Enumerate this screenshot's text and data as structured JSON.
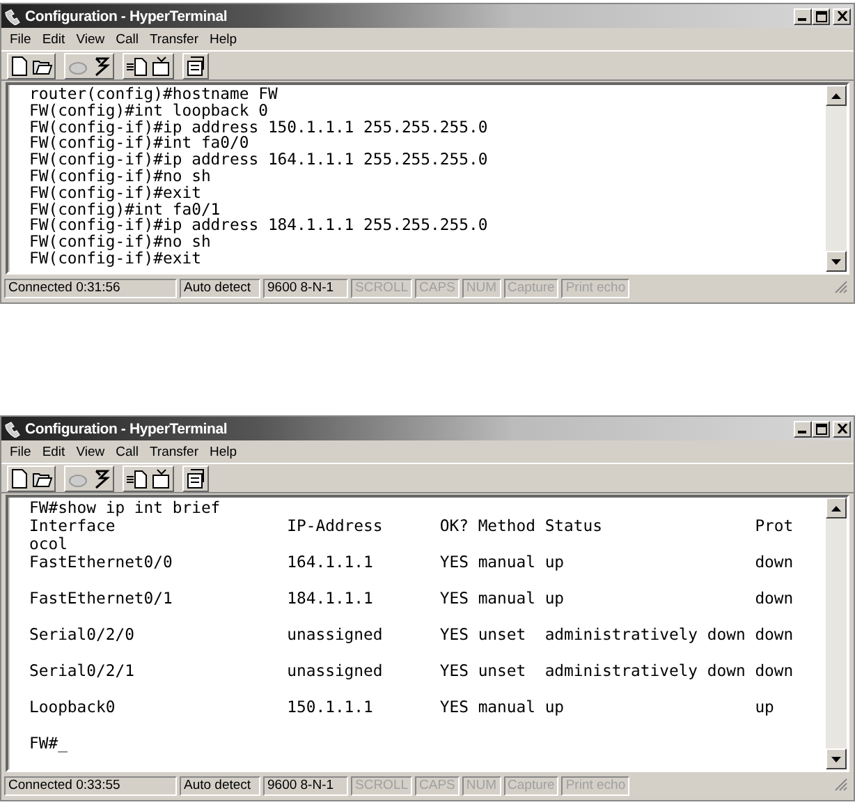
{
  "windows": [
    {
      "title": "Configuration - HyperTerminal",
      "menu": [
        "File",
        "Edit",
        "View",
        "Call",
        "Transfer",
        "Help"
      ],
      "terminal_lines": [
        "router(config)#hostname FW",
        "FW(config)#int loopback 0",
        "FW(config-if)#ip address 150.1.1.1 255.255.255.0",
        "FW(config-if)#int fa0/0",
        "FW(config-if)#ip address 164.1.1.1 255.255.255.0",
        "FW(config-if)#no sh",
        "FW(config-if)#exit",
        "FW(config)#int fa0/1",
        "FW(config-if)#ip address 184.1.1.1 255.255.255.0",
        "FW(config-if)#no sh",
        "FW(config-if)#exit"
      ],
      "status_bar": [
        {
          "text": "Connected 0:31:56",
          "disabled": false
        },
        {
          "text": "Auto detect",
          "disabled": false
        },
        {
          "text": "9600 8-N-1",
          "disabled": false
        },
        {
          "text": "SCROLL",
          "disabled": true
        },
        {
          "text": "CAPS",
          "disabled": true
        },
        {
          "text": "NUM",
          "disabled": true
        },
        {
          "text": "Capture",
          "disabled": true
        },
        {
          "text": "Print echo",
          "disabled": true
        }
      ]
    },
    {
      "title": "Configuration - HyperTerminal",
      "menu": [
        "File",
        "Edit",
        "View",
        "Call",
        "Transfer",
        "Help"
      ],
      "terminal_lines": [
        "FW#show ip int brief",
        "Interface                  IP-Address      OK? Method Status                Prot",
        "ocol",
        {
          "text": "FastEthernet0/0            164.1.1.1       YES manual up                    down",
          "blank_after": true
        },
        {
          "text": "FastEthernet0/1            184.1.1.1       YES manual up                    down",
          "blank_after": true
        },
        {
          "text": "Serial0/2/0                unassigned      YES unset  administratively down down",
          "blank_after": true
        },
        {
          "text": "Serial0/2/1                unassigned      YES unset  administratively down down",
          "blank_after": true
        },
        {
          "text": "Loopback0                  150.1.1.1       YES manual up                    up",
          "blank_after": true
        },
        "FW#_"
      ],
      "status_bar": [
        {
          "text": "Connected 0:33:55",
          "disabled": false
        },
        {
          "text": "Auto detect",
          "disabled": false
        },
        {
          "text": "9600 8-N-1",
          "disabled": false
        },
        {
          "text": "SCROLL",
          "disabled": true
        },
        {
          "text": "CAPS",
          "disabled": true
        },
        {
          "text": "NUM",
          "disabled": true
        },
        {
          "text": "Capture",
          "disabled": true
        },
        {
          "text": "Print echo",
          "disabled": true
        }
      ]
    }
  ]
}
